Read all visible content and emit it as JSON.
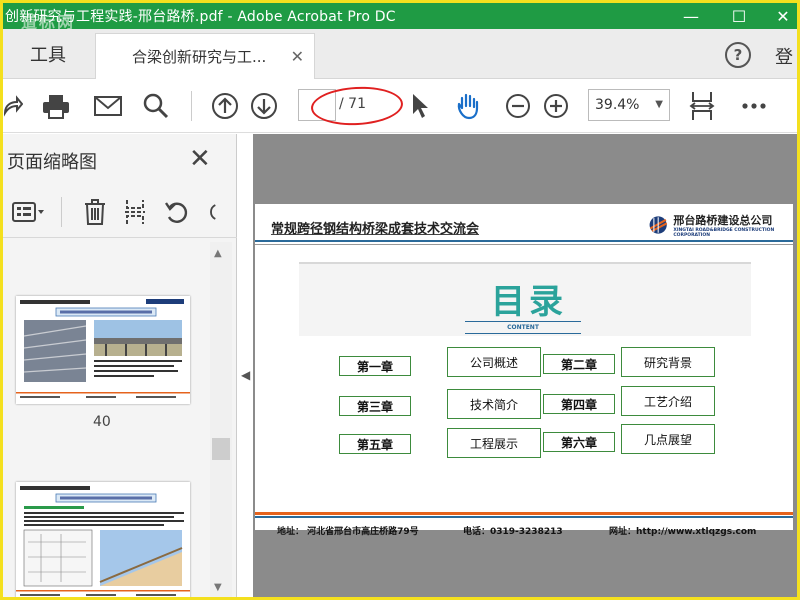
{
  "window": {
    "title": "创新研究与工程实践-邢台路桥.pdf - Adobe Acrobat Pro DC",
    "watermark": "道标网",
    "minimize": "—",
    "maximize": "☐",
    "close": "✕"
  },
  "tabs": {
    "tools_label": "工具",
    "doc_tab_label": "合梁创新研究与工...",
    "doc_tab_close": "✕",
    "help_label": "?",
    "login_label": "登"
  },
  "toolbar": {
    "page_current": "",
    "page_total": "/ 71",
    "zoom": "39.4%"
  },
  "left_panel": {
    "title": "页面缩略图",
    "close": "✕",
    "thumbnails": [
      {
        "page_label": "40"
      },
      {
        "page_label": ""
      }
    ]
  },
  "slide": {
    "title": "常规跨径钢结构桥梁成套技术交流会",
    "company_name": "邢台路桥建设总公司",
    "company_en": "XINGTAI ROAD&BRIDGE CONSTRUCTION CORPORATION",
    "heading": "目录",
    "heading_sub": "CONTENT",
    "chapters": [
      {
        "label": "第一章",
        "item": "公司概述"
      },
      {
        "label": "第二章",
        "item": "研究背景"
      },
      {
        "label": "第三章",
        "item": "技术简介"
      },
      {
        "label": "第四章",
        "item": "工艺介绍"
      },
      {
        "label": "第五章",
        "item": "工程展示"
      },
      {
        "label": "第六章",
        "item": "几点展望"
      }
    ],
    "footer_address": "地址： 河北省邢台市高庄桥路79号",
    "footer_phone": "电话：0319-3238213",
    "footer_web": "网址：http://www.xtlqzgs.com"
  },
  "colors": {
    "titlebar": "#1f9b44",
    "frame": "#f4e01e",
    "accent_teal": "#2ba39b",
    "chapter_border": "#3d8b3d",
    "footer_orange": "#e5631d",
    "footer_blue": "#2a6a9a",
    "highlight_oval": "#e02020"
  }
}
